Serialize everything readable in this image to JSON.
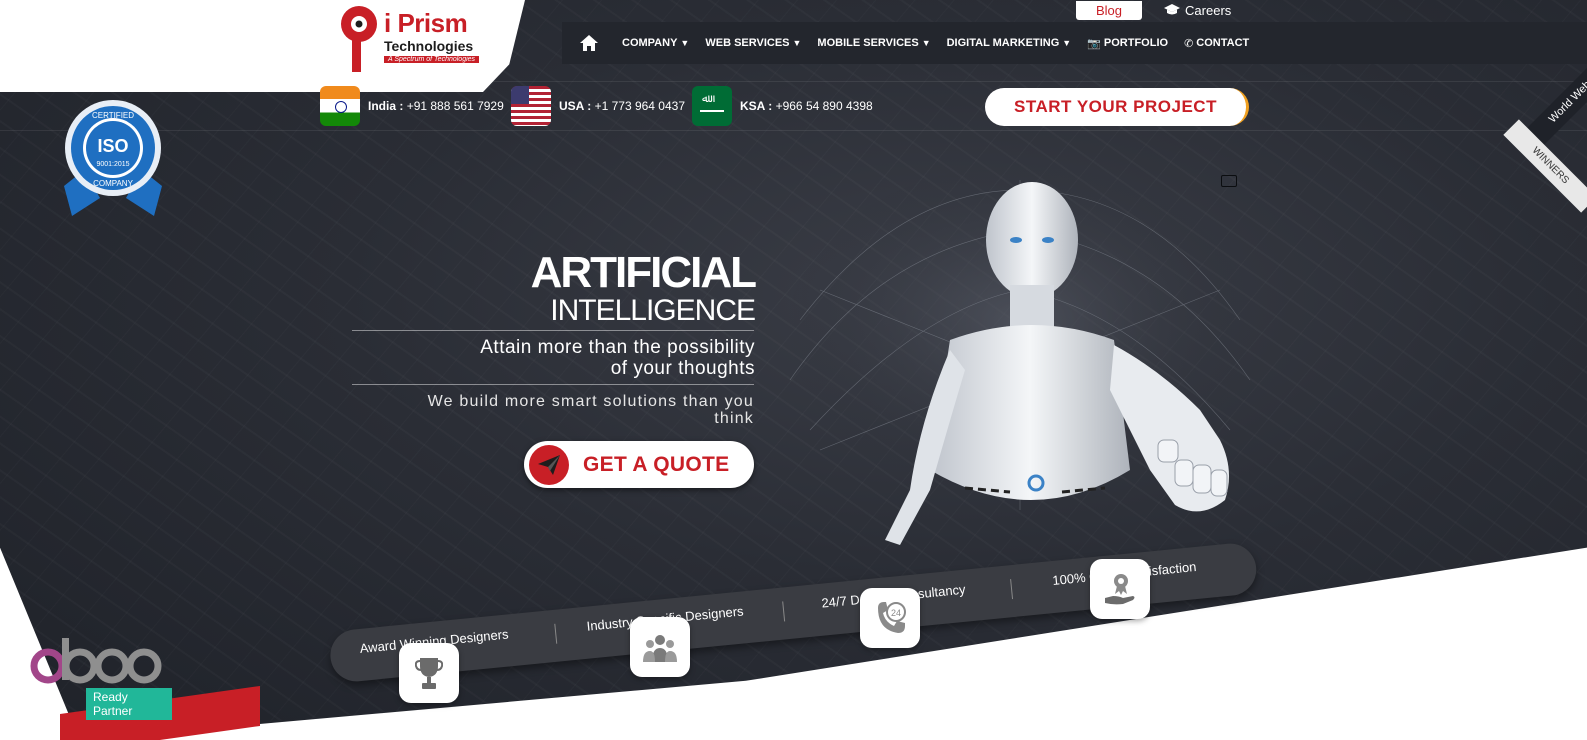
{
  "header": {
    "logo": {
      "name": "i Prism",
      "sub": "Technologies",
      "tagline": "A Spectrum of Technologies"
    },
    "util": {
      "blog": "Blog",
      "careers": "Careers"
    },
    "nav": [
      {
        "label": "COMPANY",
        "dropdown": true
      },
      {
        "label": "WEB SERVICES",
        "dropdown": true
      },
      {
        "label": "MOBILE SERVICES",
        "dropdown": true
      },
      {
        "label": "DIGITAL MARKETING",
        "dropdown": true
      },
      {
        "label": "PORTFOLIO",
        "dropdown": false
      },
      {
        "label": "CONTACT",
        "dropdown": false
      }
    ]
  },
  "contacts": [
    {
      "country": "India :",
      "phone": "+91 888 561 7929"
    },
    {
      "country": "USA :",
      "phone": "+1 773 964 0437"
    },
    {
      "country": "KSA :",
      "phone": "+966 54 890 4398"
    }
  ],
  "cta": {
    "start_project": "START YOUR PROJECT"
  },
  "iso": {
    "top": "CERTIFIED",
    "main": "ISO",
    "code": "9001:2015",
    "bottom": "COMPANY"
  },
  "hero": {
    "title": "ARTIFICIAL",
    "subtitle": "INTELLIGENCE",
    "tagline_1": "Attain more than the possibility",
    "tagline_2": "of your thoughts",
    "description_1": "We build more smart solutions than you",
    "description_2": "think",
    "quote_button": "GET A QUOTE"
  },
  "features": [
    {
      "label": "Award Winning Designers",
      "icon": "trophy-icon"
    },
    {
      "label": "Industry Specific Designers",
      "icon": "team-icon"
    },
    {
      "label": "24/7 Design Consultancy",
      "icon": "support-24-icon"
    },
    {
      "label": "100% Client Statisfaction",
      "icon": "award-hand-icon"
    }
  ],
  "odoo": {
    "word": "odoo",
    "badge": "Ready Partner"
  },
  "ribbon": {
    "line1": "World Web",
    "line2": "WINNERS"
  },
  "colors": {
    "brand_red": "#c81f26",
    "dark_bg": "#2a2d35",
    "nav_bg": "#23262d",
    "odoo_green": "#21b799",
    "odoo_purple": "#a24689"
  }
}
